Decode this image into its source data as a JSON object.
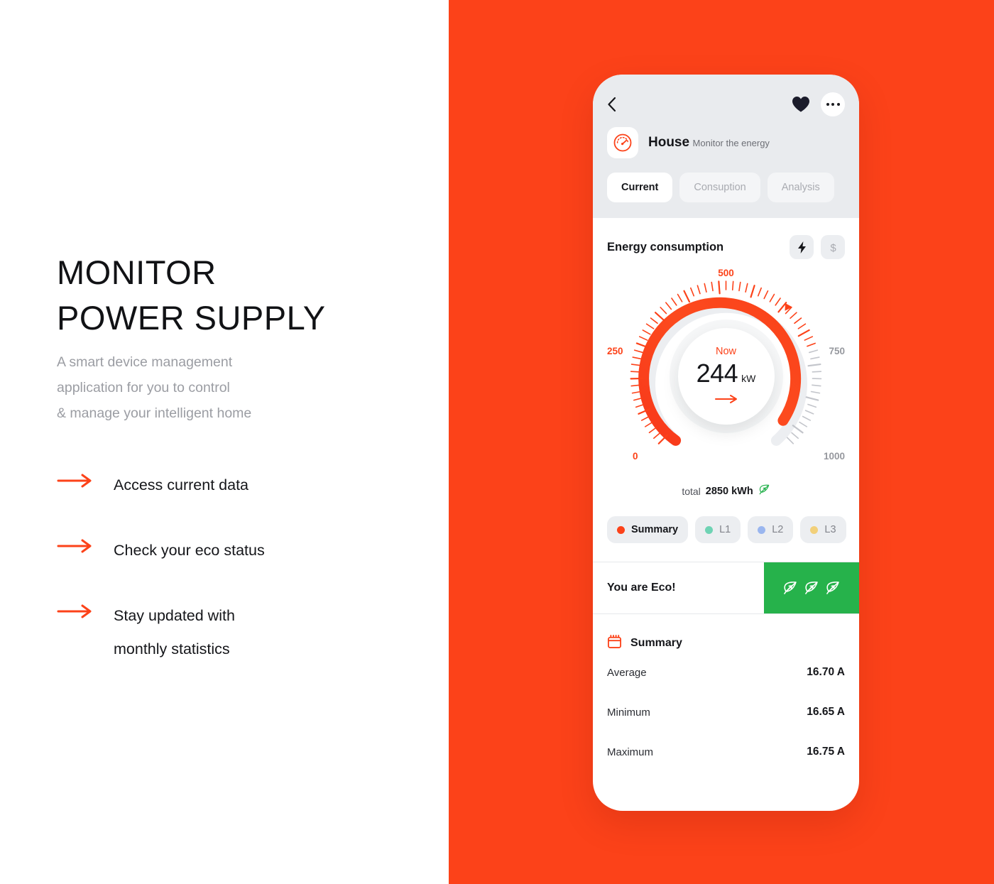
{
  "brand": {
    "accent": "#fc4219",
    "green": "#26b24b",
    "dark": "#15161a",
    "muted": "#9b9da3"
  },
  "left_panel": {
    "headline_line1": "MONITOR",
    "headline_line2": "POWER SUPPLY",
    "sub_line1": "A smart device management",
    "sub_line2": "application for you to control",
    "sub_line3": "& manage your intelligent home",
    "features": [
      {
        "icon": "arrow-right-icon",
        "line1": "Access  current data",
        "line2": ""
      },
      {
        "icon": "arrow-right-icon",
        "line1": "Check your eco status",
        "line2": ""
      },
      {
        "icon": "arrow-right-icon",
        "line1": "Stay updated with",
        "line2": "monthly statistics"
      }
    ]
  },
  "phone": {
    "header": {
      "back_icon": "chevron-left-icon",
      "favorite_icon": "heart-filled-icon",
      "more_icon": "more-horizontal-icon",
      "device_icon": "gauge-speedometer-icon",
      "title": "House",
      "subtitle": "Monitor the energy",
      "tabs": [
        {
          "label": "Current",
          "active": true
        },
        {
          "label": "Consuption",
          "active": false
        },
        {
          "label": "Analysis",
          "active": false
        }
      ]
    },
    "energy": {
      "section_title": "Energy consumption",
      "toggle_buttons": [
        {
          "icon": "lightning-bolt-icon",
          "label": "",
          "active": true
        },
        {
          "icon": "dollar-sign-icon",
          "label": "$",
          "active": false
        }
      ],
      "gauge": {
        "now_label": "Now",
        "value": "244",
        "unit": "kW",
        "detail_icon": "arrow-right-icon",
        "ticks": [
          "0",
          "250",
          "500",
          "750",
          "1000"
        ]
      },
      "total_label": "total",
      "total_value": "2850 kWh",
      "total_icon": "leaf-icon",
      "legend": [
        {
          "label": "Summary",
          "color": "#fc4219",
          "active": true
        },
        {
          "label": "L1",
          "color": "#6fd3b4",
          "active": false
        },
        {
          "label": "L2",
          "color": "#9ab6ef",
          "active": false
        },
        {
          "label": "L3",
          "color": "#f2d07a",
          "active": false
        }
      ]
    },
    "eco": {
      "label": "You are Eco!",
      "badge_icon": "leaf-icon",
      "badge_count": 3
    },
    "summary": {
      "icon": "calendar-icon",
      "title": "Summary",
      "rows": [
        {
          "label": "Average",
          "value": "16.70 A"
        },
        {
          "label": "Minimum",
          "value": "16.65 A"
        },
        {
          "label": "Maximum",
          "value": "16.75 A"
        }
      ]
    }
  },
  "chart_data": {
    "type": "gauge",
    "title": "Energy consumption",
    "value": 244,
    "unit": "kW",
    "min": 0,
    "max": 1000,
    "tick_labels": [
      0,
      250,
      500,
      750,
      1000
    ],
    "filled_to": 730,
    "red_ticks_to": 760,
    "total": 2850,
    "total_unit": "kWh",
    "series": [
      {
        "name": "Summary",
        "color": "#fc4219"
      },
      {
        "name": "L1",
        "color": "#6fd3b4"
      },
      {
        "name": "L2",
        "color": "#9ab6ef"
      },
      {
        "name": "L3",
        "color": "#f2d07a"
      }
    ],
    "stats": {
      "average": 16.7,
      "minimum": 16.65,
      "maximum": 16.75,
      "stat_unit": "A"
    }
  }
}
